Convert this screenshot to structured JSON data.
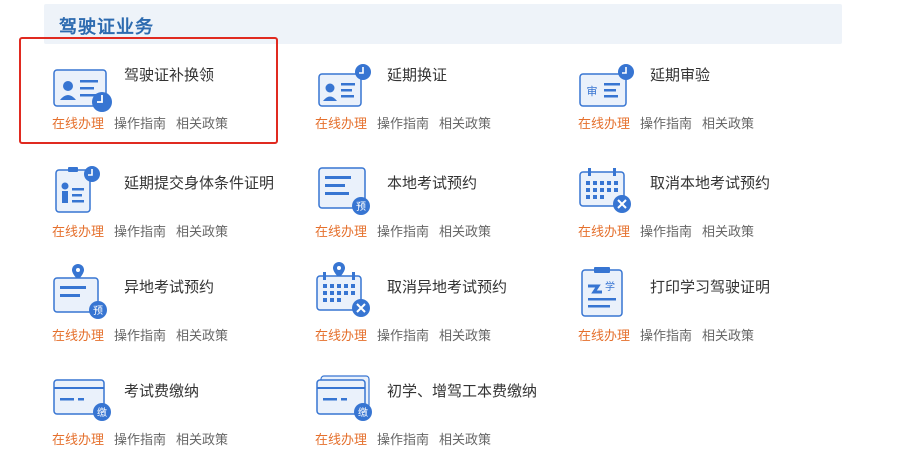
{
  "section": {
    "title": "驾驶证业务"
  },
  "colors": {
    "accent_blue": "#2d6bb0",
    "icon_blue": "#3775d2",
    "online_orange": "#e5702d",
    "highlight_red": "#e02a20"
  },
  "items": [
    {
      "title": "驾驶证补换领",
      "icon": "license-card-clock-icon",
      "links": [
        "在线办理",
        "操作指南",
        "相关政策"
      ]
    },
    {
      "title": "延期换证",
      "icon": "license-card-clock-icon",
      "links": [
        "在线办理",
        "操作指南",
        "相关政策"
      ]
    },
    {
      "title": "延期审验",
      "icon": "review-card-clock-icon",
      "links": [
        "在线办理",
        "操作指南",
        "相关政策"
      ]
    },
    {
      "title": "延期提交身体条件证明",
      "icon": "badge-person-clock-icon",
      "links": [
        "在线办理",
        "操作指南",
        "相关政策"
      ]
    },
    {
      "title": "本地考试预约",
      "icon": "form-reserve-icon",
      "links": [
        "在线办理",
        "操作指南",
        "相关政策"
      ]
    },
    {
      "title": "取消本地考试预约",
      "icon": "calendar-cancel-icon",
      "links": [
        "在线办理",
        "操作指南",
        "相关政策"
      ]
    },
    {
      "title": "异地考试预约",
      "icon": "location-form-reserve-icon",
      "links": [
        "在线办理",
        "操作指南",
        "相关政策"
      ]
    },
    {
      "title": "取消异地考试预约",
      "icon": "location-calendar-cancel-icon",
      "links": [
        "在线办理",
        "操作指南",
        "相关政策"
      ]
    },
    {
      "title": "打印学习驾驶证明",
      "icon": "learner-certificate-icon",
      "links": [
        "在线办理",
        "操作指南",
        "相关政策"
      ]
    },
    {
      "title": "考试费缴纳",
      "icon": "fee-card-icon",
      "links": [
        "在线办理",
        "操作指南",
        "相关政策"
      ]
    },
    {
      "title": "初学、增驾工本费缴纳",
      "icon": "fee-card-stack-icon",
      "links": [
        "在线办理",
        "操作指南",
        "相关政策"
      ]
    }
  ],
  "icon_glyphs": {
    "reserve": "预",
    "review": "审",
    "learner": "学",
    "fee": "缴"
  }
}
